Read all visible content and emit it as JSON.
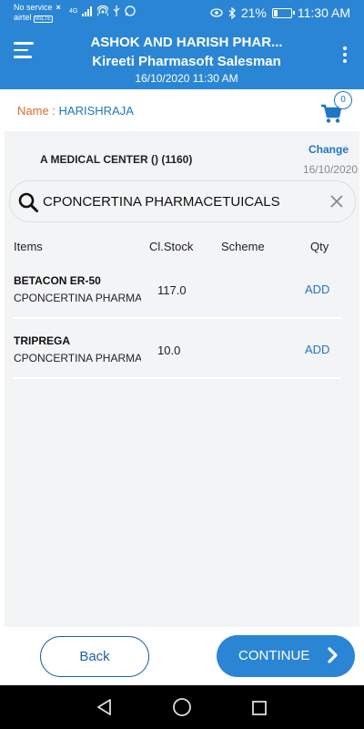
{
  "status_bar": {
    "carrier_line1": "No service",
    "carrier_line2": "airtel",
    "volte": "VoLTE",
    "network": "4G",
    "battery": "21%",
    "battery_level": 0.21,
    "time": "11:30 AM"
  },
  "app_bar": {
    "title": "ASHOK AND HARISH PHAR...",
    "subtitle": "Kireeti Pharmasoft Salesman",
    "datetime": "16/10/2020 11:30 AM"
  },
  "user": {
    "name_label": "Name : ",
    "name_value": "HARISHRAJA"
  },
  "cart": {
    "count": "0"
  },
  "customer": {
    "name": "A MEDICAL CENTER () (1160)",
    "change_label": "Change",
    "date": "16/10/2020"
  },
  "search": {
    "value": "CPONCERTINA PHARMACETUICALS"
  },
  "table": {
    "headers": {
      "items": "Items",
      "stock": "Cl.Stock",
      "scheme": "Scheme",
      "qty": "Qty"
    },
    "rows": [
      {
        "name": "BETACON ER-50",
        "company": "CPONCERTINA PHARMACETUICALS",
        "stock": "117.0",
        "scheme": "",
        "action": "ADD"
      },
      {
        "name": "TRIPREGA",
        "company": "CPONCERTINA PHARMACETUICALS",
        "stock": "10.0",
        "scheme": "",
        "action": "ADD"
      }
    ]
  },
  "buttons": {
    "back": "Back",
    "continue": "CONTINUE"
  },
  "colors": {
    "primary": "#2a86d4",
    "accent_text": "#1f76c2",
    "name_label": "#e06a2c",
    "background": "#f3f4f6"
  },
  "icons": {
    "menu": "hamburger-icon",
    "more": "more-vert-icon",
    "cart": "cart-icon",
    "search": "search-icon",
    "clear": "close-icon",
    "continue": "chevron-right-icon"
  }
}
